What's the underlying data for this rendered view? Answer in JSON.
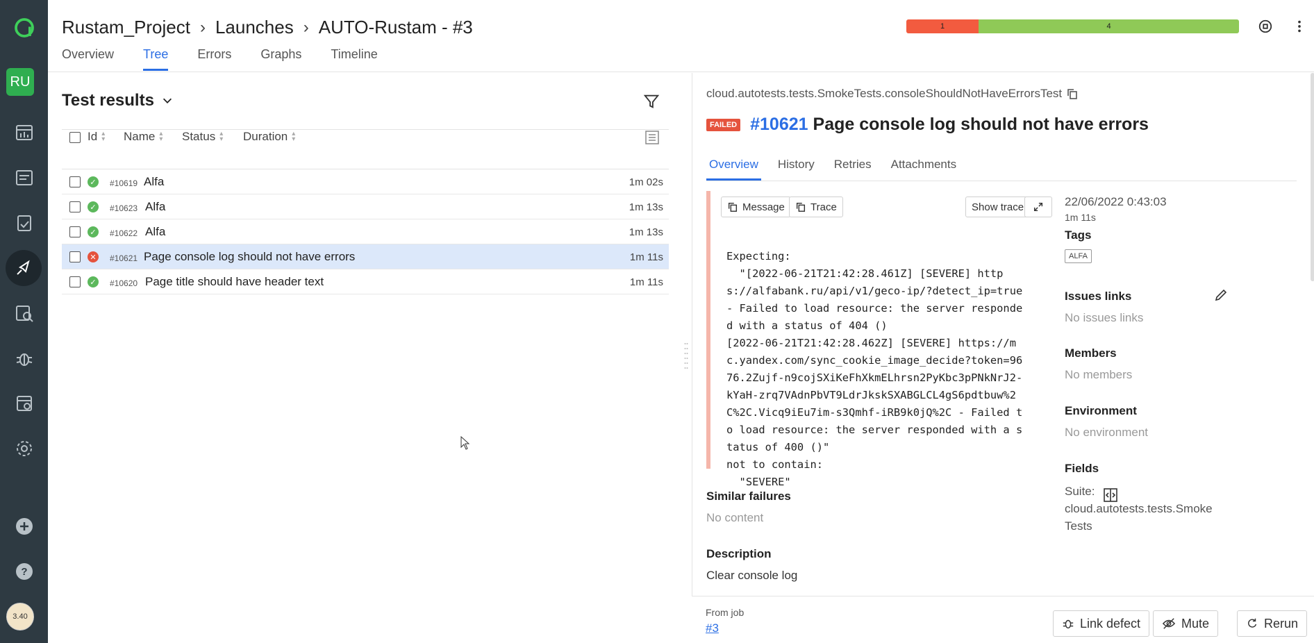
{
  "sidebar": {
    "project_badge": "RU",
    "avatar_text": "3.40",
    "items": [
      "dashboard",
      "launches-list",
      "filters",
      "launches",
      "debug",
      "plugins",
      "project-settings",
      "settings",
      "add",
      "help"
    ]
  },
  "header": {
    "breadcrumb": [
      "Rustam_Project",
      "Launches",
      "AUTO-Rustam - #3"
    ],
    "tabs": [
      "Overview",
      "Tree",
      "Errors",
      "Graphs",
      "Timeline"
    ],
    "active_tab": "Tree",
    "stats": {
      "failed": "1",
      "passed": "4"
    }
  },
  "left": {
    "title": "Test results",
    "columns": [
      "Id",
      "Name",
      "Status",
      "Duration"
    ],
    "rows": [
      {
        "id": "#10619",
        "name": "Alfa",
        "duration": "1m 02s",
        "status": "passed"
      },
      {
        "id": "#10623",
        "name": "Alfa",
        "duration": "1m 13s",
        "status": "passed"
      },
      {
        "id": "#10622",
        "name": "Alfa",
        "duration": "1m 13s",
        "status": "passed"
      },
      {
        "id": "#10621",
        "name": "Page console log should not have errors",
        "duration": "1m 11s",
        "status": "failed"
      },
      {
        "id": "#10620",
        "name": "Page title should have header text",
        "duration": "1m 11s",
        "status": "passed"
      }
    ]
  },
  "right": {
    "path": "cloud.autotests.tests.SmokeTests.consoleShouldNotHaveErrorsTest",
    "status_badge": "FAILED",
    "test_id": "#10621",
    "test_title": "Page console log should not have errors",
    "tabs": [
      "Overview",
      "History",
      "Retries",
      "Attachments"
    ],
    "buttons": {
      "message": "Message",
      "trace": "Trace",
      "show_trace": "Show trace"
    },
    "error_text": "Expecting:\n  \"[2022-06-21T21:42:28.461Z] [SEVERE] https://alfabank.ru/api/v1/geco-ip/?detect_ip=true - Failed to load resource: the server responded with a status of 404 ()\n[2022-06-21T21:42:28.462Z] [SEVERE] https://mc.yandex.com/sync_cookie_image_decide?token=9676.2Zujf-n9cojSXiKeFhXkmELhrsn2PyKbc3pPNkNrJ2-kYaH-zrq7VAdnPbVT9LdrJkskSXABGLCL4gS6pdtbuw%2C%2C.Vicq9iEu7im-s3Qmhf-iRB9k0jQ%2C - Failed to load resource: the server responded with a status of 400 ()\"\nnot to contain:\n  \"SEVERE\"",
    "meta": {
      "date": "22/06/2022 0:43:03",
      "duration": "1m 11s",
      "tags_label": "Tags",
      "tag": "ALFA",
      "issues_label": "Issues links",
      "issues_value": "No issues links",
      "members_label": "Members",
      "members_value": "No members",
      "env_label": "Environment",
      "env_value": "No environment",
      "fields_label": "Fields",
      "fields_value": "Suite:\ncloud.autotests.tests.Smoke\nTests"
    },
    "similar_label": "Similar failures",
    "similar_value": "No content",
    "description_label": "Description",
    "description_value": "Clear console log",
    "from_job_label": "From job",
    "from_job_link": "#3",
    "footer_buttons": {
      "link_defect": "Link defect",
      "mute": "Mute",
      "rerun": "Rerun"
    }
  },
  "colors": {
    "accent": "#2b6ee4",
    "failed": "#e5533d",
    "passed": "#5cb85c",
    "sidebar": "#2e3a42"
  }
}
